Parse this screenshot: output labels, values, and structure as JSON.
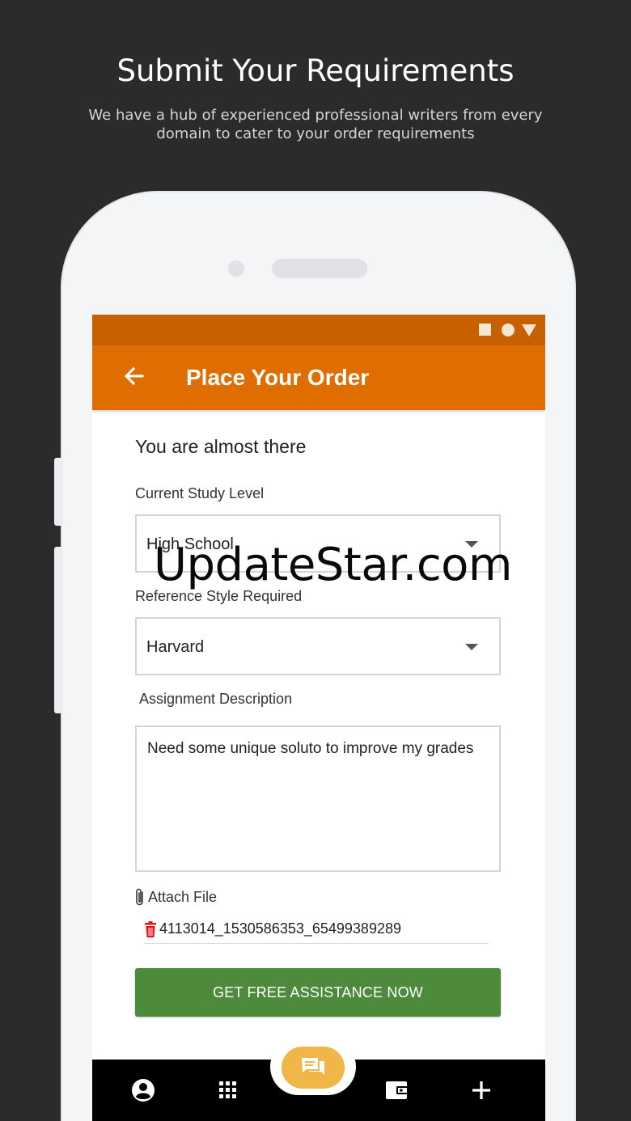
{
  "promo": {
    "title": "Submit Your Requirements",
    "subtitle": "We have a hub of experienced professional writers from every domain to cater to your order requirements"
  },
  "app_bar": {
    "title": "Place Your Order",
    "back_icon": "arrow-left-icon"
  },
  "status_bar": {
    "icons": [
      "square-icon",
      "circle-icon",
      "triangle-icon"
    ],
    "color": "#c76100"
  },
  "form": {
    "heading": "You are almost there",
    "study_level": {
      "label": "Current Study Level",
      "value": "High School"
    },
    "reference_style": {
      "label": "Reference Style Required",
      "value": "Harvard"
    },
    "description": {
      "label": "Assignment Description",
      "value": "Need some unique soluto to improve my grades"
    },
    "attach": {
      "label": "Attach File",
      "icon": "paperclip-icon"
    },
    "file": {
      "name": "4113014_1530586353_65499389289",
      "icon": "trash-icon"
    },
    "submit_label": "GET FREE ASSISTANCE NOW"
  },
  "bottom_nav": {
    "items": [
      "profile-icon",
      "grid-icon",
      "chat-icon",
      "wallet-icon",
      "plus-icon"
    ]
  },
  "watermark": "UpdateStar.com",
  "colors": {
    "accent": "#e06d00",
    "button": "#4e8a3b",
    "chat_fab": "#f0b648",
    "background": "#2b2b2b"
  }
}
